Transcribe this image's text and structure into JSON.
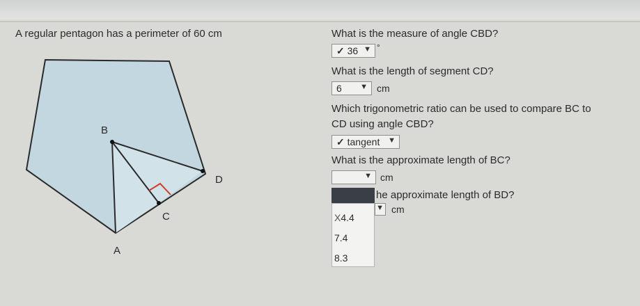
{
  "header": {
    "cut_text": "                                            "
  },
  "problem": {
    "statement": "A regular pentagon has a perimeter of 60 cm"
  },
  "diagram": {
    "labels": {
      "b": "B",
      "d": "D",
      "c": "C",
      "a": "A"
    }
  },
  "questions": [
    {
      "text": "What is the measure of angle CBD?",
      "answer": "36",
      "unit": "°",
      "check": "✓"
    },
    {
      "text": "What is the length of segment CD?",
      "answer": "6",
      "unit": "cm"
    },
    {
      "text_line1": "Which trigonometric ratio can be used to compare BC to",
      "text_line2": "CD using angle CBD?",
      "answer": "tangent",
      "check": "✓"
    },
    {
      "text": "What is the approximate length of BC?",
      "answer": "",
      "unit": "cm"
    },
    {
      "text": "he approximate length of BD?",
      "answer": "",
      "unit": "cm",
      "wrong_mark": "X",
      "options": [
        "4.4",
        "7.4",
        "8.3"
      ]
    }
  ],
  "colors": {
    "pentagon_fill": "#c2d7df",
    "stroke": "#2a2a2a",
    "right_angle": "#d03a2a",
    "highlight": "#3a3f47"
  }
}
